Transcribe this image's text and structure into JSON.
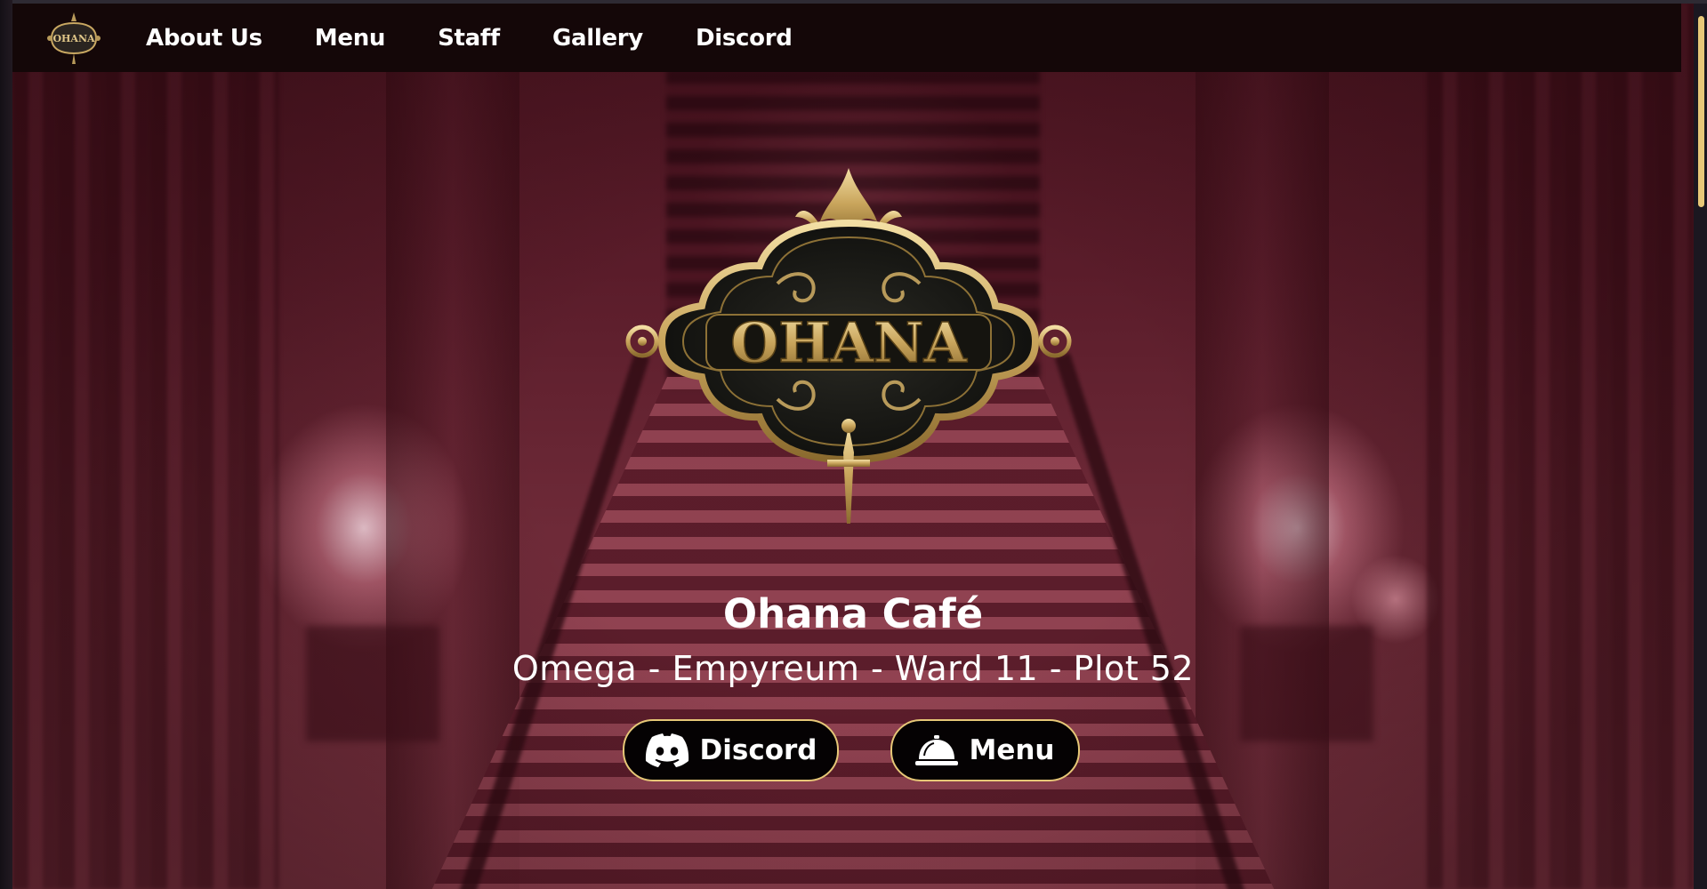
{
  "nav": {
    "logo_text": "OHANA",
    "links": [
      "About Us",
      "Menu",
      "Staff",
      "Gallery",
      "Discord"
    ]
  },
  "hero": {
    "logo_text": "OHANA",
    "title": "Ohana Café",
    "subtitle": "Omega - Empyreum - Ward 11 - Plot 52",
    "discord_button": "Discord",
    "menu_button": "Menu"
  },
  "icons": {
    "discord": "discord-icon",
    "menu": "service-bell-icon"
  },
  "colors": {
    "accent_gold": "#e6c777",
    "nav_bg": "#140708",
    "button_bg": "#050203",
    "hero_tint": "#6e2a38",
    "scrollbar_thumb": "#e8c878"
  }
}
